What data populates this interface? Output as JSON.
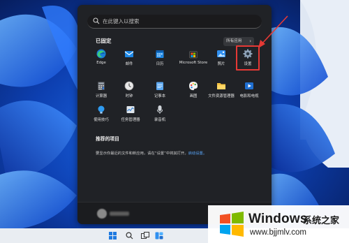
{
  "search": {
    "placeholder": "在此键入以搜索"
  },
  "pinned": {
    "title": "已固定",
    "all_apps_label": "所有应用",
    "apps": [
      {
        "label": "Edge",
        "icon": "edge-icon"
      },
      {
        "label": "邮件",
        "icon": "mail-icon"
      },
      {
        "label": "日历",
        "icon": "calendar-icon"
      },
      {
        "label": "Microsoft Store",
        "icon": "store-icon"
      },
      {
        "label": "照片",
        "icon": "photos-icon"
      },
      {
        "label": "设置",
        "icon": "settings-gear-icon"
      },
      {
        "label": "计算器",
        "icon": "calculator-icon"
      },
      {
        "label": "时钟",
        "icon": "clock-icon"
      },
      {
        "label": "记事本",
        "icon": "notepad-icon"
      },
      {
        "label": "画图",
        "icon": "paint-icon"
      },
      {
        "label": "文件资源管理器",
        "icon": "folder-icon"
      },
      {
        "label": "电影和电视",
        "icon": "movies-tv-icon"
      },
      {
        "label": "使用技巧",
        "icon": "tips-icon"
      },
      {
        "label": "任务管理器",
        "icon": "task-manager-icon"
      },
      {
        "label": "录音机",
        "icon": "voice-recorder-icon"
      }
    ]
  },
  "recommended": {
    "title": "推荐的项目",
    "text": "要显示你最近的文件和新应用，请在“设置”中将其打开。",
    "link": "启动设置。"
  },
  "watermark": {
    "brand": "Windows",
    "cn": "系统之家",
    "url": "www.bjjmlv.com"
  },
  "colors": {
    "accent_highlight": "#e53935",
    "link": "#5aa9ff",
    "menu_bg": "#202226"
  }
}
